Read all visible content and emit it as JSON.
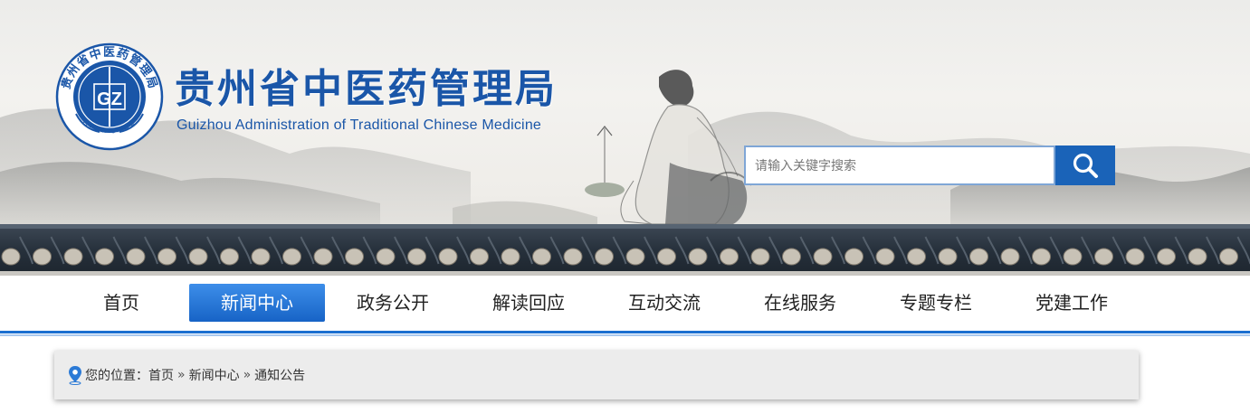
{
  "header": {
    "title": "贵州省中医药管理局",
    "subtitle": "Guizhou  Administration of Traditional Chinese Medicine",
    "logo": {
      "ring_text": "贵州省中医药管理局",
      "center_text": "GZ",
      "bottom_text": "ATCM of GZ"
    },
    "colors": {
      "brand": "#1a56a8",
      "accent": "#1a63b8"
    }
  },
  "search": {
    "placeholder": "请输入关键字搜索",
    "value": "",
    "button_icon": "search-icon"
  },
  "nav": {
    "items": [
      {
        "label": "首页",
        "active": false
      },
      {
        "label": "新闻中心",
        "active": true
      },
      {
        "label": "政务公开",
        "active": false
      },
      {
        "label": "解读回应",
        "active": false
      },
      {
        "label": "互动交流",
        "active": false
      },
      {
        "label": "在线服务",
        "active": false
      },
      {
        "label": "专题专栏",
        "active": false
      },
      {
        "label": "党建工作",
        "active": false
      }
    ]
  },
  "breadcrumb": {
    "icon": "location-pin-icon",
    "prefix": "您的位置：",
    "items": [
      "首页",
      "新闻中心",
      "通知公告"
    ],
    "separator": "»"
  }
}
